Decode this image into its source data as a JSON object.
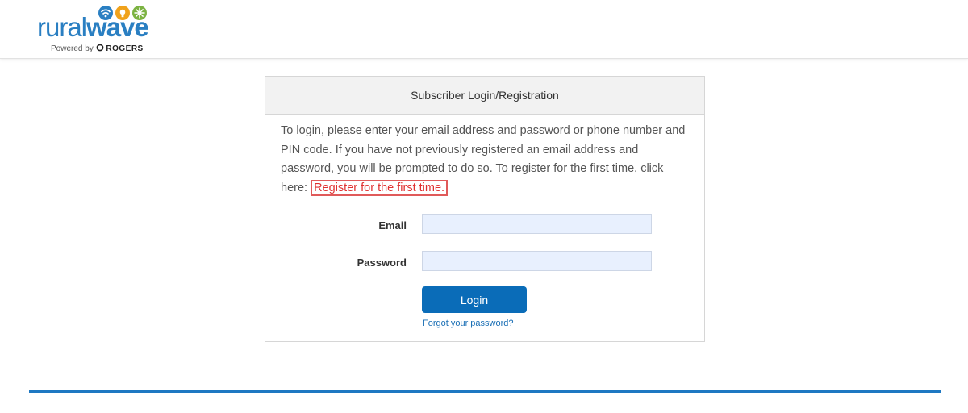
{
  "brand": {
    "logo_part1": "rural",
    "logo_part2": "wave",
    "powered_prefix": "Powered by",
    "powered_brand": "ROGERS"
  },
  "panel": {
    "title": "Subscriber Login/Registration",
    "intro_text": "To login, please enter your email address and password or phone number and PIN code. If you have not previously registered an email address and password, you will be prompted to do so. To register for the first time, click here:",
    "register_link": "Register for the first time."
  },
  "form": {
    "email_label": "Email",
    "email_value": "",
    "password_label": "Password",
    "password_value": "",
    "login_label": "Login",
    "forgot_label": "Forgot your password?"
  },
  "colors": {
    "brand_blue": "#2a7fc2",
    "button_blue": "#0a6cb8",
    "link_red": "#e03131",
    "footer_line": "#1e78c2"
  }
}
